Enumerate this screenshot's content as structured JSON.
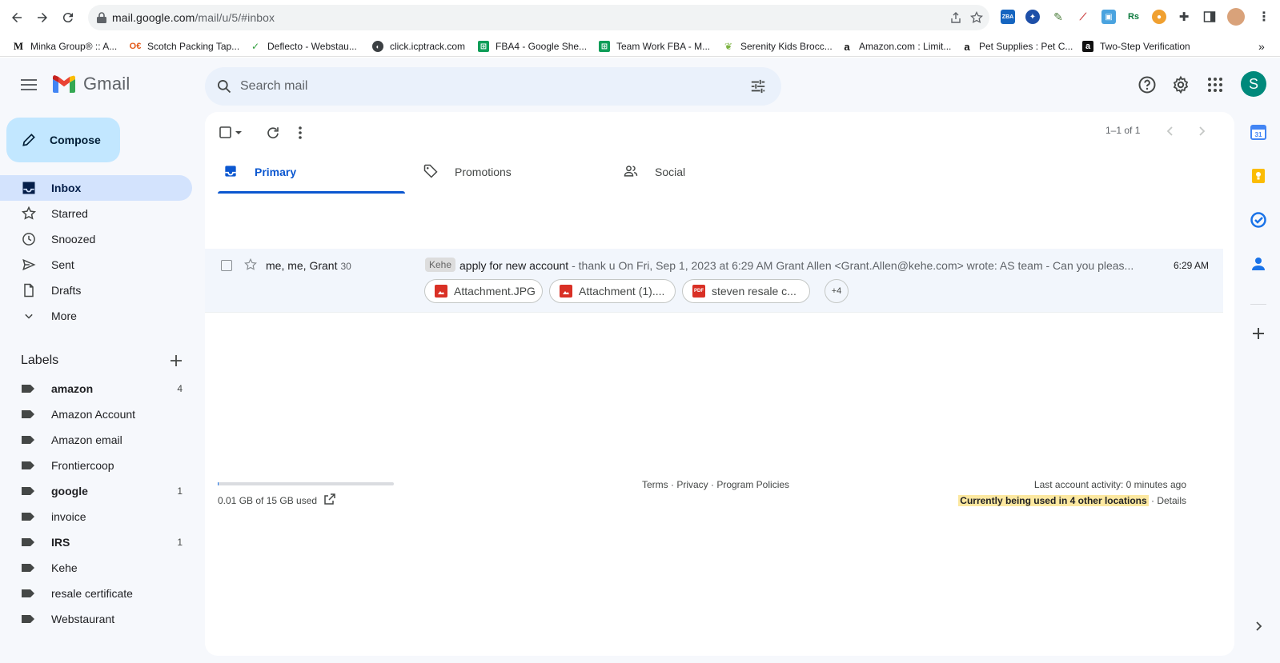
{
  "browser": {
    "url_host": "mail.google.com",
    "url_path": "/mail/u/5/#inbox",
    "bookmarks": [
      {
        "label": "Minka Group® :: A...",
        "icon": "minka-icon"
      },
      {
        "label": "Scotch Packing Tap...",
        "icon": "scotch-icon"
      },
      {
        "label": "Deflecto - Webstau...",
        "icon": "deflecto-icon"
      },
      {
        "label": "click.icptrack.com",
        "icon": "globe-icon"
      },
      {
        "label": "FBA4 - Google She...",
        "icon": "sheets-icon"
      },
      {
        "label": "Team Work FBA - M...",
        "icon": "sheets-icon"
      },
      {
        "label": "Serenity Kids Brocc...",
        "icon": "leaf-icon"
      },
      {
        "label": "Amazon.com : Limit...",
        "icon": "amazon-icon"
      },
      {
        "label": "Pet Supplies : Pet C...",
        "icon": "amazon-icon"
      },
      {
        "label": "Two-Step Verification",
        "icon": "amazon-black-icon"
      }
    ],
    "more_bookmarks": "»"
  },
  "gmail": {
    "app_name": "Gmail",
    "search_placeholder": "Search mail",
    "avatar_letter": "S",
    "compose_label": "Compose",
    "nav": [
      {
        "label": "Inbox",
        "icon": "inbox-icon",
        "active": true
      },
      {
        "label": "Starred",
        "icon": "star-icon"
      },
      {
        "label": "Snoozed",
        "icon": "clock-icon"
      },
      {
        "label": "Sent",
        "icon": "send-icon"
      },
      {
        "label": "Drafts",
        "icon": "draft-icon"
      },
      {
        "label": "More",
        "icon": "chevron-down-icon"
      }
    ],
    "labels_heading": "Labels",
    "labels": [
      {
        "label": "amazon",
        "bold": true,
        "count": "4"
      },
      {
        "label": "Amazon Account",
        "bold": false,
        "count": ""
      },
      {
        "label": "Amazon email",
        "bold": false,
        "count": ""
      },
      {
        "label": "Frontiercoop",
        "bold": false,
        "count": ""
      },
      {
        "label": "google",
        "bold": true,
        "count": "1"
      },
      {
        "label": "invoice",
        "bold": false,
        "count": ""
      },
      {
        "label": "IRS",
        "bold": true,
        "count": "1"
      },
      {
        "label": "Kehe",
        "bold": false,
        "count": ""
      },
      {
        "label": "resale certificate",
        "bold": false,
        "count": ""
      },
      {
        "label": "Webstaurant",
        "bold": false,
        "count": ""
      }
    ],
    "pager_text": "1–1 of 1",
    "tabs": [
      {
        "label": "Primary",
        "icon": "inbox-tab-icon",
        "active": true
      },
      {
        "label": "Promotions",
        "icon": "tag-icon"
      },
      {
        "label": "Social",
        "icon": "people-icon"
      }
    ],
    "email": {
      "sender": "me, me, Grant",
      "count": "30",
      "tag": "Kehe",
      "subject": "apply for new account",
      "snippet": " - thank u On Fri, Sep 1, 2023 at 6:29 AM Grant Allen <Grant.Allen@kehe.com> wrote: AS team - Can you pleas...",
      "time": "6:29 AM",
      "attachments": [
        {
          "name": "Attachment.JPG",
          "type": "image"
        },
        {
          "name": "Attachment (1)....",
          "type": "image"
        },
        {
          "name": "steven resale c...",
          "type": "pdf"
        }
      ],
      "more_attachments": "+4"
    },
    "footer": {
      "storage": "0.01 GB of 15 GB used",
      "storage_fraction": 0.001,
      "links": "Terms · Privacy · Program Policies",
      "activity": "Last account activity: 0 minutes ago",
      "locations_highlight": "Currently being used in 4 other locations",
      "details": " · Details"
    }
  },
  "colors": {
    "gmail_bg": "#f6f8fc",
    "accent_blue": "#0b57d0",
    "compose_bg": "#c2e7ff",
    "active_nav": "#d3e3fd",
    "avatar_bg": "#00897b"
  }
}
